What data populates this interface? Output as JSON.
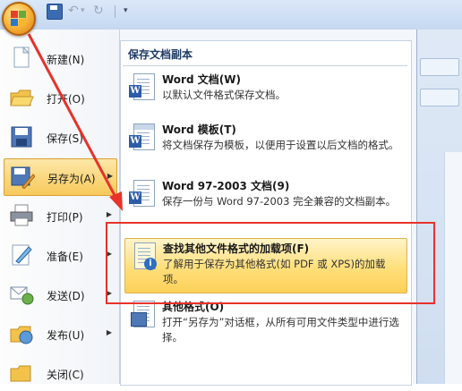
{
  "quick_access": {
    "more_label": "▾"
  },
  "left_menu": [
    {
      "id": "new",
      "label": "新建(N)",
      "icon": "new-document-icon",
      "has_submenu": false
    },
    {
      "id": "open",
      "label": "打开(O)",
      "icon": "open-folder-icon",
      "has_submenu": false
    },
    {
      "id": "save",
      "label": "保存(S)",
      "icon": "save-disk-icon",
      "has_submenu": false
    },
    {
      "id": "save-as",
      "label": "另存为(A)",
      "icon": "save-as-icon",
      "has_submenu": true,
      "selected": true
    },
    {
      "id": "print",
      "label": "打印(P)",
      "icon": "printer-icon",
      "has_submenu": true
    },
    {
      "id": "prepare",
      "label": "准备(E)",
      "icon": "prepare-icon",
      "has_submenu": true
    },
    {
      "id": "send",
      "label": "发送(D)",
      "icon": "send-icon",
      "has_submenu": true
    },
    {
      "id": "publish",
      "label": "发布(U)",
      "icon": "publish-icon",
      "has_submenu": true
    },
    {
      "id": "close",
      "label": "关闭(C)",
      "icon": "close-folder-icon",
      "has_submenu": false
    }
  ],
  "right_panel": {
    "title": "保存文档副本",
    "items": [
      {
        "id": "word-doc",
        "title": "Word 文档(W)",
        "desc": "以默认文件格式保存文档。",
        "icon": "word-document-icon"
      },
      {
        "id": "word-template",
        "title": "Word 模板(T)",
        "desc": "将文档保存为模板，以便用于设置以后文档的格式。",
        "icon": "word-template-icon"
      },
      {
        "id": "word-97",
        "title": "Word 97-2003 文档(9)",
        "desc": "保存一份与 Word 97-2003 完全兼容的文档副本。",
        "icon": "word-97-icon"
      },
      {
        "id": "find-addins",
        "title": "查找其他文件格式的加载项(F)",
        "desc": "了解用于保存为其他格式(如 PDF 或 XPS)的加载项。",
        "icon": "info-document-icon",
        "highlighted": true
      },
      {
        "id": "other-formats",
        "title": "其他格式(O)",
        "desc": "打开“另存为”对话框，从所有可用文件类型中进行选择。",
        "icon": "other-formats-icon"
      }
    ]
  },
  "colors": {
    "annotation": "#e8322a",
    "selected_bg": "#f7c95a",
    "accent": "#1e3b66"
  }
}
